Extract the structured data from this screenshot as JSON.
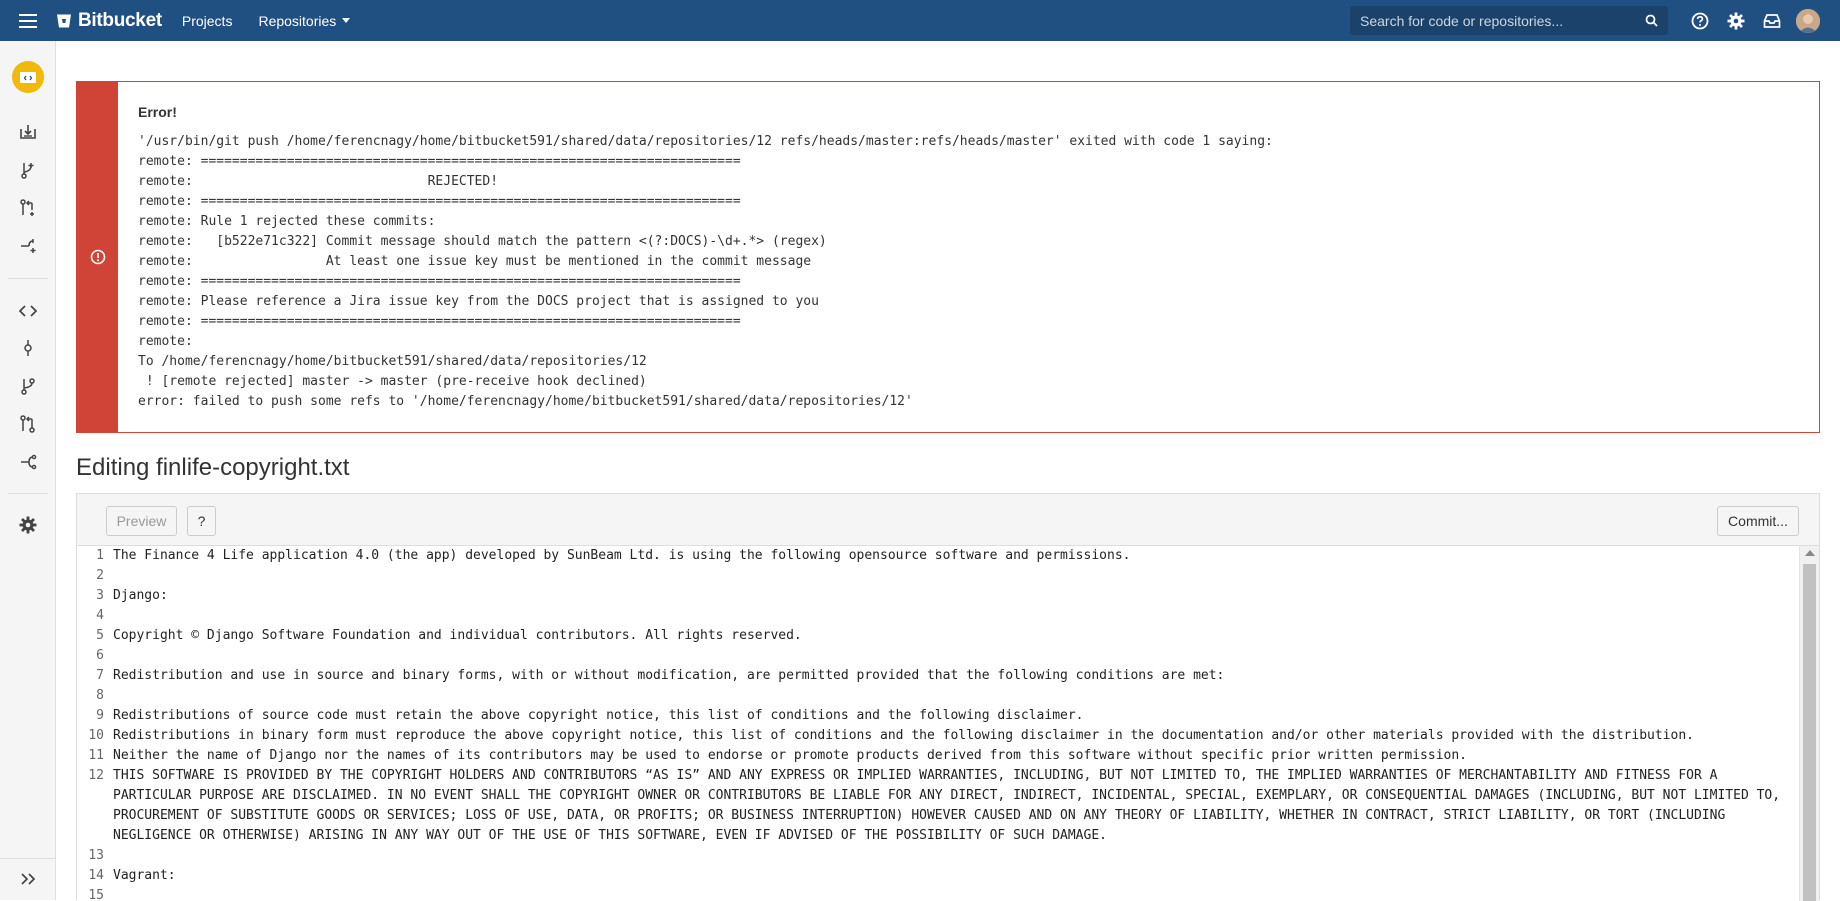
{
  "header": {
    "brand": "Bitbucket",
    "nav": {
      "projects": "Projects",
      "repositories": "Repositories"
    },
    "search_placeholder": "Search for code or repositories..."
  },
  "error": {
    "title": "Error!",
    "message": "'/usr/bin/git push /home/ferencnagy/home/bitbucket591/shared/data/repositories/12 refs/heads/master:refs/heads/master' exited with code 1 saying:\nremote: =====================================================================\nremote:                              REJECTED!\nremote: =====================================================================\nremote: Rule 1 rejected these commits:\nremote:   [b522e71c322] Commit message should match the pattern <(?:DOCS)-\\d+.*> (regex)\nremote:                 At least one issue key must be mentioned in the commit message\nremote: =====================================================================\nremote: Please reference a Jira issue key from the DOCS project that is assigned to you\nremote: =====================================================================\nremote:\nTo /home/ferencnagy/home/bitbucket591/shared/data/repositories/12\n ! [remote rejected] master -> master (pre-receive hook declined)\nerror: failed to push some refs to '/home/ferencnagy/home/bitbucket591/shared/data/repositories/12'"
  },
  "editor": {
    "title": "Editing finlife-copyright.txt",
    "preview_label": "Preview",
    "help_label": "?",
    "commit_label": "Commit...",
    "lines": [
      {
        "n": "1",
        "text": "The Finance 4 Life application 4.0 (the app) developed by SunBeam Ltd. is using the following opensource software and permissions."
      },
      {
        "n": "2",
        "text": ""
      },
      {
        "n": "3",
        "text": "Django:"
      },
      {
        "n": "4",
        "text": ""
      },
      {
        "n": "5",
        "text": "Copyright © Django Software Foundation and individual contributors. All rights reserved."
      },
      {
        "n": "6",
        "text": ""
      },
      {
        "n": "7",
        "text": "Redistribution and use in source and binary forms, with or without modification, are permitted provided that the following conditions are met:"
      },
      {
        "n": "8",
        "text": ""
      },
      {
        "n": "9",
        "text": "Redistributions of source code must retain the above copyright notice, this list of conditions and the following disclaimer."
      },
      {
        "n": "10",
        "text": "Redistributions in binary form must reproduce the above copyright notice, this list of conditions and the following disclaimer in the documentation and/or other materials provided with the distribution."
      },
      {
        "n": "11",
        "text": "Neither the name of Django nor the names of its contributors may be used to endorse or promote products derived from this software without specific prior written permission."
      },
      {
        "n": "12",
        "text": "THIS SOFTWARE IS PROVIDED BY THE COPYRIGHT HOLDERS AND CONTRIBUTORS “AS IS” AND ANY EXPRESS OR IMPLIED WARRANTIES, INCLUDING, BUT NOT LIMITED TO, THE IMPLIED WARRANTIES OF MERCHANTABILITY AND FITNESS FOR A PARTICULAR PURPOSE ARE DISCLAIMED. IN NO EVENT SHALL THE COPYRIGHT OWNER OR CONTRIBUTORS BE LIABLE FOR ANY DIRECT, INDIRECT, INCIDENTAL, SPECIAL, EXEMPLARY, OR CONSEQUENTIAL DAMAGES (INCLUDING, BUT NOT LIMITED TO, PROCUREMENT OF SUBSTITUTE GOODS OR SERVICES; LOSS OF USE, DATA, OR PROFITS; OR BUSINESS INTERRUPTION) HOWEVER CAUSED AND ON ANY THEORY OF LIABILITY, WHETHER IN CONTRACT, STRICT LIABILITY, OR TORT (INCLUDING NEGLIGENCE OR OTHERWISE) ARISING IN ANY WAY OUT OF THE USE OF THIS SOFTWARE, EVEN IF ADVISED OF THE POSSIBILITY OF SUCH DAMAGE."
      },
      {
        "n": "13",
        "text": ""
      },
      {
        "n": "14",
        "text": "Vagrant:"
      },
      {
        "n": "15",
        "text": ""
      }
    ]
  },
  "colors": {
    "header": "#205081",
    "error": "#d04437",
    "repo_avatar": "#f0b90b"
  },
  "icons": {
    "sidebar": [
      "repo-avatar-icon",
      "clone-icon",
      "create-branch-icon",
      "create-pull-request-icon",
      "fork-icon",
      "source-icon",
      "commits-icon",
      "branches-icon",
      "pull-requests-icon",
      "forks-icon",
      "settings-icon",
      "expand-icon"
    ],
    "header": [
      "menu-icon",
      "bitbucket-logo-icon",
      "search-icon",
      "help-icon",
      "gear-icon",
      "inbox-icon",
      "avatar"
    ]
  }
}
